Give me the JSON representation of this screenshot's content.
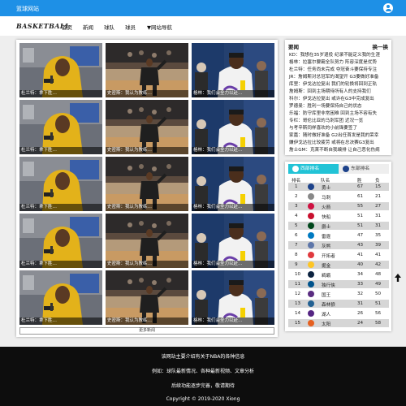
{
  "header": {
    "site_name": "篮球网站"
  },
  "nav": {
    "logo": "BASKETBALL",
    "items": [
      "首页",
      "新闻",
      "球队",
      "球员",
      "▼网站导航"
    ]
  },
  "gallery": {
    "captions": [
      "杜兰特：拿下胜…",
      "史密斯：我认为教练…",
      "格林：我们会全力以赴…"
    ],
    "more_label": "更多新闻"
  },
  "news": {
    "title": "要闻",
    "refresh_label": "换一换",
    "items": [
      "KD：我想在35岁退役 纪录不能定义我的生涯",
      "格林：拉塞尔要霸全队努力 阵容深度是优势",
      "杜兰特：任务尚未完成 夺冠奋斗要保持专注",
      "JR：詹姆斯对总冠军的渴望开 G3要做好准备",
      "库里：伊戈达拉复出 我们的轮换将回到正轨",
      "詹姆斯：回到主场期待所有人的支持我们",
      "科尔：伊戈达拉复出 或许在G3中完成复出",
      "罗德曼：胜利一场要保持自己的状态",
      "乐福：防守库里非常困难 回到主场不容有失",
      "专栏：哥伦比亚的马刺军团 近况一览",
      "与考辛斯同样喜欢的小前锋要签了",
      "家嘉：随时做好准备 G2出任首发是我的荣幸",
      "嫌伊戈达拉比较疲劳 或将在总决赛G3复出",
      "詹士GM：克莱不断自我编排 让自己恶化伤病"
    ]
  },
  "standings": {
    "tabs": {
      "west": "西部排名",
      "east": "东部排名"
    },
    "columns": {
      "rank": "排名",
      "team": "队名",
      "wins": "胜",
      "losses": "负"
    },
    "rows": [
      {
        "rank": "1",
        "team": "勇士",
        "wins": "67",
        "losses": "15",
        "color": "#1d428a"
      },
      {
        "rank": "2",
        "team": "马刺",
        "wins": "61",
        "losses": "21",
        "color": "#888888"
      },
      {
        "rank": "3",
        "team": "火箭",
        "wins": "55",
        "losses": "27",
        "color": "#ce1141"
      },
      {
        "rank": "4",
        "team": "快船",
        "wins": "51",
        "losses": "31",
        "color": "#c8102e"
      },
      {
        "rank": "5",
        "team": "爵士",
        "wins": "51",
        "losses": "31",
        "color": "#00471b"
      },
      {
        "rank": "6",
        "team": "雷霆",
        "wins": "47",
        "losses": "35",
        "color": "#007ac1"
      },
      {
        "rank": "7",
        "team": "灰熊",
        "wins": "43",
        "losses": "39",
        "color": "#5d76a9"
      },
      {
        "rank": "8",
        "team": "开拓者",
        "wins": "41",
        "losses": "41",
        "color": "#e03a3e"
      },
      {
        "rank": "9",
        "team": "掘金",
        "wins": "40",
        "losses": "42",
        "color": "#fec524"
      },
      {
        "rank": "10",
        "team": "鹈鹕",
        "wins": "34",
        "losses": "48",
        "color": "#0c2340"
      },
      {
        "rank": "11",
        "team": "独行侠",
        "wins": "33",
        "losses": "49",
        "color": "#00538c"
      },
      {
        "rank": "12",
        "team": "国王",
        "wins": "32",
        "losses": "50",
        "color": "#5a2d81"
      },
      {
        "rank": "13",
        "team": "森林狼",
        "wins": "31",
        "losses": "51",
        "color": "#236192"
      },
      {
        "rank": "14",
        "team": "湖人",
        "wins": "26",
        "losses": "56",
        "color": "#552583"
      },
      {
        "rank": "15",
        "team": "太阳",
        "wins": "24",
        "losses": "58",
        "color": "#e56020"
      }
    ]
  },
  "footer": {
    "lines": [
      "该网站主要介绍有关于NBA的各种信息",
      "例如：球队最新情况、各种最新视频、文章分析",
      "后续功能逐步完善，敬请期待",
      "Copyright © 2019-2020 Xiong"
    ]
  },
  "colors": {
    "header": "#1e90e6",
    "tab_active": "#22c3d6",
    "footer": "#0d0d0d"
  }
}
